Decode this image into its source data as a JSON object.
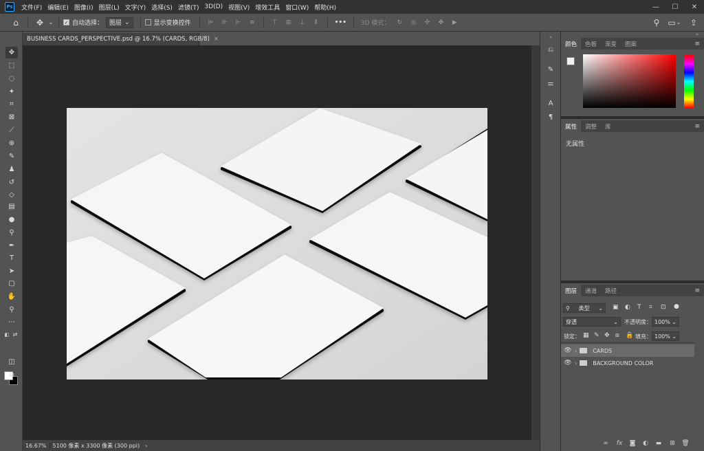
{
  "app": {
    "logo": "Ps"
  },
  "menu": [
    "文件(F)",
    "编辑(E)",
    "图像(I)",
    "图层(L)",
    "文字(Y)",
    "选择(S)",
    "滤镜(T)",
    "3D(D)",
    "视图(V)",
    "增效工具",
    "窗口(W)",
    "帮助(H)"
  ],
  "window_controls": {
    "minimize": "—",
    "maximize": "☐",
    "close": "✕"
  },
  "options": {
    "auto_select_label": "自动选择：",
    "auto_select_value": "图层",
    "transform_label": "显示变换控件",
    "more": "•••",
    "mode_3d": "3D 模式："
  },
  "document": {
    "tab_title": "BUSINESS CARDS_PERSPECTIVE.psd @ 16.7% (CARDS, RGB/8)",
    "tab_close": "×",
    "zoom": "16.67%",
    "doc_info": "5100 像素 x 3300 像素 (300 ppi)",
    "status_arrow": "›"
  },
  "color_panel": {
    "tabs": [
      "颜色",
      "色板",
      "渐变",
      "图案"
    ],
    "active": 0
  },
  "properties_panel": {
    "tabs": [
      "属性",
      "调整",
      "库"
    ],
    "active": 0,
    "content": "无属性"
  },
  "layers_panel": {
    "tabs": [
      "图层",
      "通道",
      "路径"
    ],
    "active": 0,
    "filter_label": "类型",
    "blend_mode": "穿透",
    "opacity_label": "不透明度：",
    "opacity_value": "100%",
    "lock_label": "锁定：",
    "fill_label": "填充：",
    "fill_value": "100%",
    "layers": [
      {
        "name": "CARDS",
        "selected": true
      },
      {
        "name": "BACKGROUND COLOR",
        "selected": false
      }
    ]
  },
  "colors": {
    "accent": "#31a8ff",
    "canvas_bg": "#282828",
    "image_bg": "#dcdcdc",
    "card": "#f4f4f4"
  }
}
